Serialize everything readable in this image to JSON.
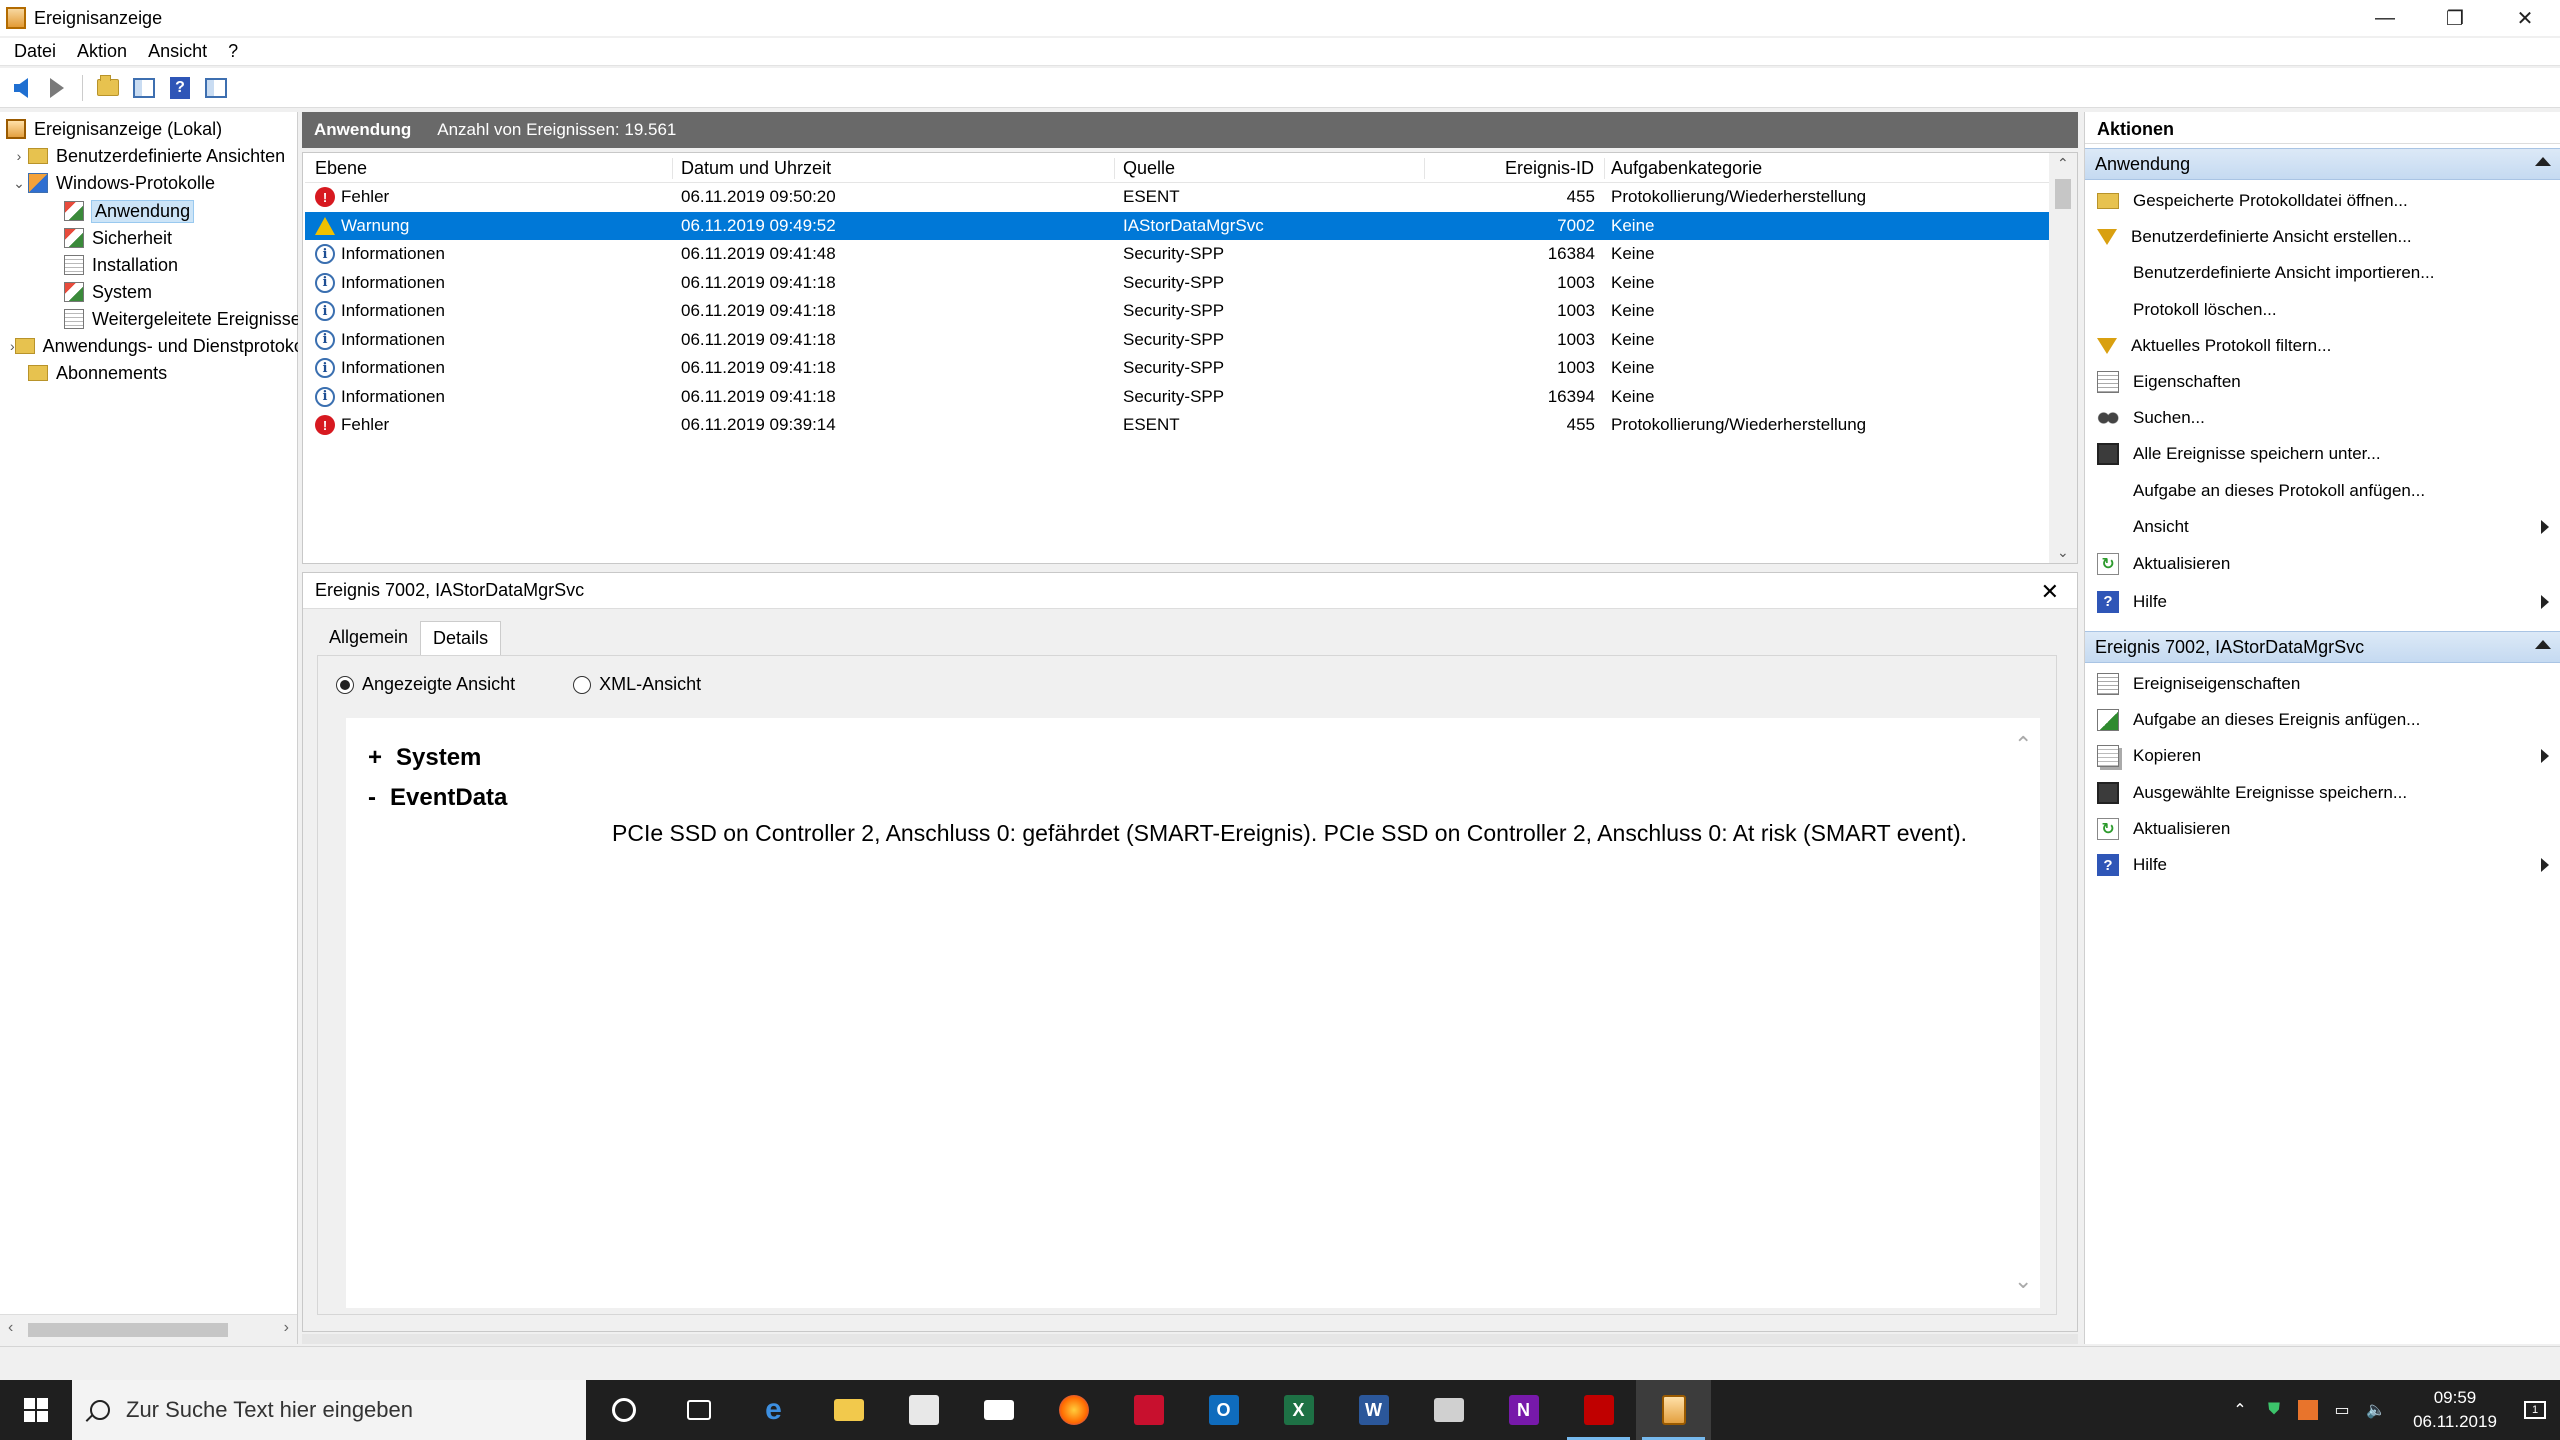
{
  "window": {
    "title": "Ereignisanzeige",
    "controls": [
      "—",
      "❐",
      "✕"
    ]
  },
  "menu": [
    "Datei",
    "Aktion",
    "Ansicht",
    "?"
  ],
  "nav": {
    "items": [
      {
        "label": "Ereignisanzeige (Lokal)"
      },
      {
        "label": "Benutzerdefinierte Ansichten"
      },
      {
        "label": "Windows-Protokolle"
      },
      {
        "label": "Anwendung"
      },
      {
        "label": "Sicherheit"
      },
      {
        "label": "Installation"
      },
      {
        "label": "System"
      },
      {
        "label": "Weitergeleitete Ereignisse"
      },
      {
        "label": "Anwendungs- und Dienstprotokolle"
      },
      {
        "label": "Abonnements"
      }
    ]
  },
  "log_header": {
    "name": "Anwendung",
    "count": "Anzahl von Ereignissen: 19.561"
  },
  "events": {
    "columns": [
      "Ebene",
      "Datum und Uhrzeit",
      "Quelle",
      "Ereignis-ID",
      "Aufgabenkategorie"
    ],
    "rows": [
      {
        "level": "Fehler",
        "date": "06.11.2019 09:50:20",
        "source": "ESENT",
        "id": "455",
        "category": "Protokollierung/Wiederherstellung"
      },
      {
        "level": "Warnung",
        "date": "06.11.2019 09:49:52",
        "source": "IAStorDataMgrSvc",
        "id": "7002",
        "category": "Keine"
      },
      {
        "level": "Informationen",
        "date": "06.11.2019 09:41:48",
        "source": "Security-SPP",
        "id": "16384",
        "category": "Keine"
      },
      {
        "level": "Informationen",
        "date": "06.11.2019 09:41:18",
        "source": "Security-SPP",
        "id": "1003",
        "category": "Keine"
      },
      {
        "level": "Informationen",
        "date": "06.11.2019 09:41:18",
        "source": "Security-SPP",
        "id": "1003",
        "category": "Keine"
      },
      {
        "level": "Informationen",
        "date": "06.11.2019 09:41:18",
        "source": "Security-SPP",
        "id": "1003",
        "category": "Keine"
      },
      {
        "level": "Informationen",
        "date": "06.11.2019 09:41:18",
        "source": "Security-SPP",
        "id": "1003",
        "category": "Keine"
      },
      {
        "level": "Informationen",
        "date": "06.11.2019 09:41:18",
        "source": "Security-SPP",
        "id": "16394",
        "category": "Keine"
      },
      {
        "level": "Fehler",
        "date": "06.11.2019 09:39:14",
        "source": "ESENT",
        "id": "455",
        "category": "Protokollierung/Wiederherstellung"
      }
    ]
  },
  "detail": {
    "title": "Ereignis 7002, IAStorDataMgrSvc",
    "tabs": [
      "Allgemein",
      "Details"
    ],
    "radios": [
      "Angezeigte Ansicht",
      "XML-Ansicht"
    ],
    "nodes": [
      {
        "toggle": "+",
        "label": "System"
      },
      {
        "toggle": "-",
        "label": "EventData"
      }
    ],
    "eventdata": "PCIe SSD on Controller 2, Anschluss 0: gefährdet (SMART-Ereignis). PCIe SSD on Controller 2, Anschluss 0: At risk (SMART event)."
  },
  "actions": {
    "title": "Aktionen",
    "sections": [
      {
        "title": "Anwendung",
        "items": [
          {
            "label": "Gespeicherte Protokolldatei öffnen...",
            "icon": "open-folder-icon"
          },
          {
            "label": "Benutzerdefinierte Ansicht erstellen...",
            "icon": "filter-icon"
          },
          {
            "label": "Benutzerdefinierte Ansicht importieren...",
            "icon": ""
          },
          {
            "label": "Protokoll löschen...",
            "icon": ""
          },
          {
            "label": "Aktuelles Protokoll filtern...",
            "icon": "filter-icon"
          },
          {
            "label": "Eigenschaften",
            "icon": "properties-icon"
          },
          {
            "label": "Suchen...",
            "icon": "find-icon"
          },
          {
            "label": "Alle Ereignisse speichern unter...",
            "icon": "save-icon"
          },
          {
            "label": "Aufgabe an dieses Protokoll anfügen...",
            "icon": ""
          },
          {
            "label": "Ansicht",
            "icon": "",
            "submenu": true
          },
          {
            "label": "Aktualisieren",
            "icon": "refresh-icon"
          },
          {
            "label": "Hilfe",
            "icon": "help-icon",
            "submenu": true
          }
        ]
      },
      {
        "title": "Ereignis 7002, IAStorDataMgrSvc",
        "items": [
          {
            "label": "Ereigniseigenschaften",
            "icon": "properties-icon"
          },
          {
            "label": "Aufgabe an dieses Ereignis anfügen...",
            "icon": "task-icon"
          },
          {
            "label": "Kopieren",
            "icon": "copy-icon",
            "submenu": true
          },
          {
            "label": "Ausgewählte Ereignisse speichern...",
            "icon": "save-icon"
          },
          {
            "label": "Aktualisieren",
            "icon": "refresh-icon"
          },
          {
            "label": "Hilfe",
            "icon": "help-icon",
            "submenu": true
          }
        ]
      }
    ]
  },
  "taskbar": {
    "search_placeholder": "Zur Suche Text hier eingeben",
    "time": "09:59",
    "date": "06.11.2019",
    "colors": {
      "bar": "#1f1f1f",
      "selection": "#0078d7"
    }
  }
}
